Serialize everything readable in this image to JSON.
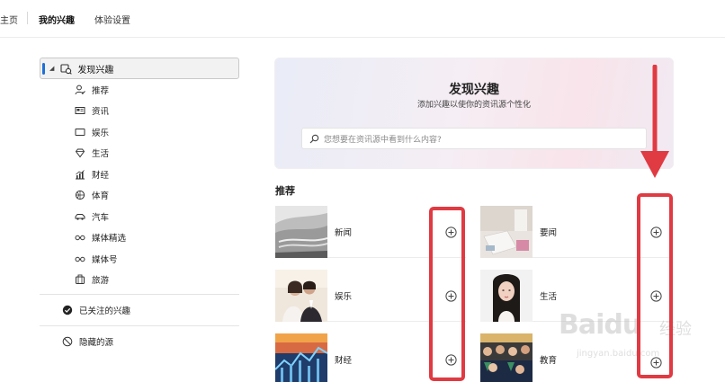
{
  "topnav": {
    "tabs": [
      {
        "label": "主页"
      },
      {
        "label": "我的兴趣"
      },
      {
        "label": "体验设置"
      }
    ]
  },
  "sidebar": {
    "selected": {
      "label": "发现兴趣",
      "icon": "discover-icon"
    },
    "items": [
      {
        "label": "推荐",
        "icon": "person-icon"
      },
      {
        "label": "资讯",
        "icon": "news-icon"
      },
      {
        "label": "娱乐",
        "icon": "screen-icon"
      },
      {
        "label": "生活",
        "icon": "diamond-icon"
      },
      {
        "label": "财经",
        "icon": "finance-chart-icon"
      },
      {
        "label": "体育",
        "icon": "ball-icon"
      },
      {
        "label": "汽车",
        "icon": "car-icon"
      },
      {
        "label": "媒体精选",
        "icon": "glasses-icon"
      },
      {
        "label": "媒体号",
        "icon": "glasses-icon"
      },
      {
        "label": "旅游",
        "icon": "luggage-icon"
      }
    ],
    "groups": [
      {
        "label": "已关注的兴趣",
        "icon": "check-circle-icon"
      },
      {
        "label": "隐藏的源",
        "icon": "block-icon"
      }
    ]
  },
  "hero": {
    "title": "发现兴趣",
    "subtitle": "添加兴趣以使你的资讯源个性化",
    "search_placeholder": "您想要在资讯源中看到什么内容?"
  },
  "section_title": "推荐",
  "cards": [
    {
      "name": "新闻"
    },
    {
      "name": "要闻"
    },
    {
      "name": "娱乐"
    },
    {
      "name": "生活"
    },
    {
      "name": "财经"
    },
    {
      "name": "教育"
    }
  ],
  "watermark": {
    "brand": "Baidu",
    "brand_cn": "经验",
    "url": "jingyan.baidu.com"
  },
  "colors": {
    "accent": "#1f6fd6",
    "annotation": "#e03a42"
  }
}
